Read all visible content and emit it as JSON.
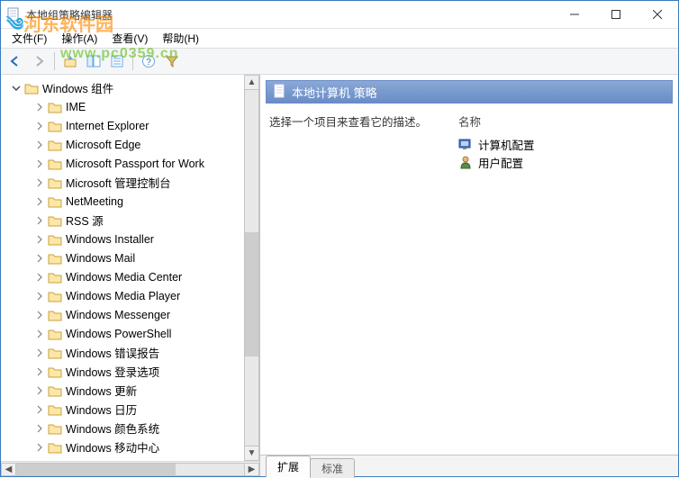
{
  "window": {
    "title": "本地组策略编辑器"
  },
  "watermark": {
    "text1": "河东软件园",
    "text2": "www.pc0359.cn"
  },
  "menu": {
    "file": "文件(F)",
    "action": "操作(A)",
    "view": "查看(V)",
    "help": "帮助(H)"
  },
  "tree": {
    "root": "Windows 组件",
    "items": [
      "IME",
      "Internet Explorer",
      "Microsoft Edge",
      "Microsoft Passport for Work",
      "Microsoft 管理控制台",
      "NetMeeting",
      "RSS 源",
      "Windows Installer",
      "Windows Mail",
      "Windows Media Center",
      "Windows Media Player",
      "Windows Messenger",
      "Windows PowerShell",
      "Windows 错误报告",
      "Windows 登录选项",
      "Windows 更新",
      "Windows 日历",
      "Windows 颜色系统",
      "Windows 移动中心"
    ]
  },
  "detail": {
    "header": "本地计算机 策略",
    "prompt": "选择一个项目来查看它的描述。",
    "column_name": "名称",
    "items": {
      "computer_config": "计算机配置",
      "user_config": "用户配置"
    }
  },
  "tabs": {
    "extended": "扩展",
    "standard": "标准"
  }
}
